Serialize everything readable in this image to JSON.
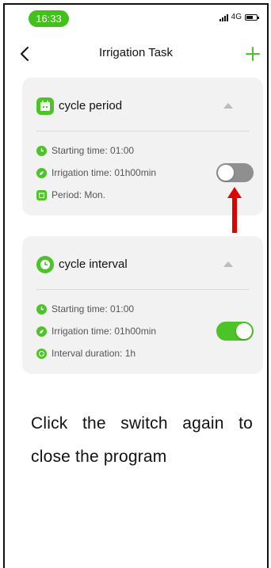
{
  "status_bar": {
    "time": "16:33",
    "network": "4G"
  },
  "header": {
    "title": "Irrigation Task"
  },
  "cards": [
    {
      "title": "cycle period",
      "rows": [
        {
          "icon": "clock-icon",
          "text": "Starting time: 01:00"
        },
        {
          "icon": "water-drop-icon",
          "text": "Irrigation time: 01h00min"
        },
        {
          "icon": "calendar-icon",
          "text": "Period: Mon."
        }
      ],
      "toggle_state": "off"
    },
    {
      "title": "cycle interval",
      "rows": [
        {
          "icon": "clock-icon",
          "text": "Starting time: 01:00"
        },
        {
          "icon": "water-drop-icon",
          "text": "Irrigation time: 01h00min"
        },
        {
          "icon": "timer-icon",
          "text": "Interval duration: 1h"
        }
      ],
      "toggle_state": "on"
    }
  ],
  "annotation": {
    "instruction": "Click the switch again to close the program"
  },
  "colors": {
    "accent": "#4cc326",
    "arrow": "#e00000",
    "toggle_off": "#8f8f8f",
    "card_bg": "#f2f2f2"
  }
}
